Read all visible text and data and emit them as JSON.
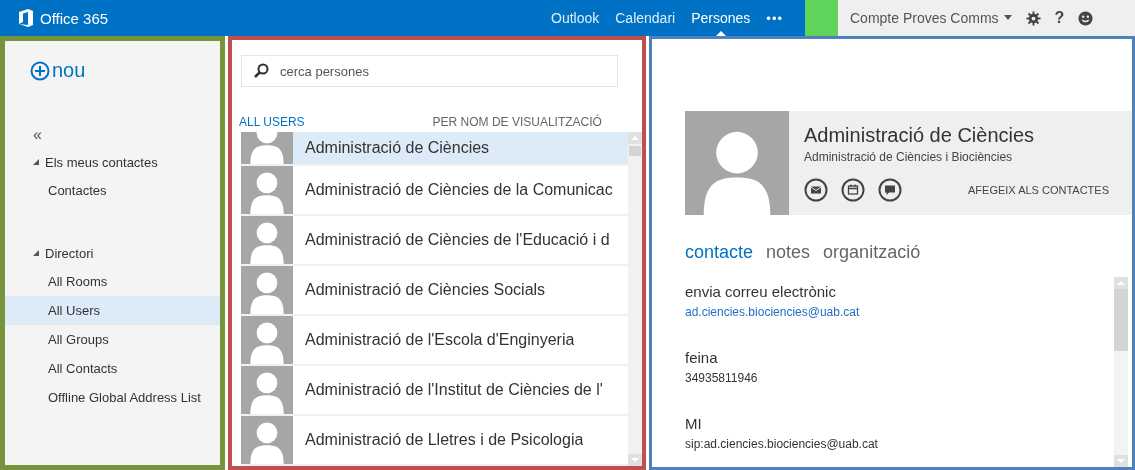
{
  "top_bar": {
    "brand": "Office 365",
    "nav": [
      {
        "label": "Outlook",
        "selected": false
      },
      {
        "label": "Calendari",
        "selected": false
      },
      {
        "label": "Persones",
        "selected": true
      }
    ],
    "more": "•••",
    "account": "Compte Proves Comms",
    "help": "?"
  },
  "sidebar": {
    "new_button": "nou",
    "collapse": "«",
    "groups": [
      {
        "label": "Els meus contactes",
        "expanded": true,
        "children": [
          {
            "label": "Contactes",
            "selected": false
          }
        ]
      },
      {
        "label": "Directori",
        "expanded": true,
        "children": [
          {
            "label": "All Rooms",
            "selected": false
          },
          {
            "label": "All Users",
            "selected": true
          },
          {
            "label": "All Groups",
            "selected": false
          },
          {
            "label": "All Contacts",
            "selected": false
          },
          {
            "label": "Offline Global Address List",
            "selected": false
          }
        ]
      }
    ]
  },
  "list": {
    "search": {
      "placeholder": "cerca persones"
    },
    "source": "ALL USERS",
    "sort": "PER NOM DE VISUALITZACIÓ",
    "rows": [
      {
        "name": "Administració de Ciències",
        "selected": true
      },
      {
        "name": "Administració de Ciències de la Comunicac",
        "selected": false
      },
      {
        "name": "Administració de Ciències de l'Educació i d",
        "selected": false
      },
      {
        "name": "Administració de Ciències Socials",
        "selected": false
      },
      {
        "name": "Administració de l'Escola d'Enginyeria",
        "selected": false
      },
      {
        "name": "Administració de l'Institut de Ciències de l'",
        "selected": false
      },
      {
        "name": "Administració de Lletres i de Psicologia",
        "selected": false
      }
    ]
  },
  "detail": {
    "name": "Administració de Ciències",
    "subtitle": "Administració de Ciències i Biociències",
    "add_to_contacts": "AFEGEIX ALS CONTACTES",
    "tabs": [
      {
        "label": "contacte",
        "selected": true
      },
      {
        "label": "notes",
        "selected": false
      },
      {
        "label": "organització",
        "selected": false
      }
    ],
    "fields": [
      {
        "label": "envia correu electrònic",
        "value": "ad.ciencies.biociencies@uab.cat",
        "kind": "link"
      },
      {
        "label": "feina",
        "value": "34935811946",
        "kind": "text"
      },
      {
        "label": "MI",
        "value": "sip:ad.ciencies.biociencies@uab.cat",
        "kind": "text"
      }
    ]
  }
}
